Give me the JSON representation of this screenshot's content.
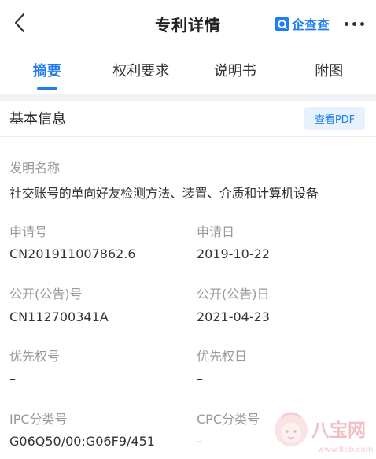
{
  "header": {
    "title": "专利详情",
    "brand_name": "企查查",
    "brand_logo_icon": "qichacha-logo-icon",
    "back_icon": "chevron-left-icon",
    "more_icon": "more-dots-icon"
  },
  "tabs": [
    {
      "label": "摘要",
      "active": true
    },
    {
      "label": "权利要求",
      "active": false
    },
    {
      "label": "说明书",
      "active": false
    },
    {
      "label": "附图",
      "active": false
    }
  ],
  "section": {
    "title": "基本信息",
    "pdf_button": "查看PDF"
  },
  "fields": {
    "invention_name": {
      "label": "发明名称",
      "value": "社交账号的单向好友检测方法、装置、介质和计算机设备"
    },
    "application_no": {
      "label": "申请号",
      "value": "CN201911007862.6"
    },
    "application_date": {
      "label": "申请日",
      "value": "2019-10-22"
    },
    "publication_no": {
      "label": "公开(公告)号",
      "value": "CN112700341A"
    },
    "publication_date": {
      "label": "公开(公告)日",
      "value": "2021-04-23"
    },
    "priority_no": {
      "label": "优先权号",
      "value": "–"
    },
    "priority_date": {
      "label": "优先权日",
      "value": "–"
    },
    "ipc": {
      "label": "IPC分类号",
      "value": "G06Q50/00;G06F9/451"
    },
    "cpc": {
      "label": "CPC分类号",
      "value": "–"
    }
  },
  "watermark": {
    "text": "八宝网",
    "url_text": "www.8bb.com"
  },
  "colors": {
    "accent": "#1f7df0",
    "label_gray": "#999999",
    "text": "#333333"
  }
}
